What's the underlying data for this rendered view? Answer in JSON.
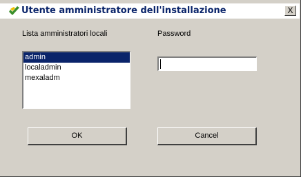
{
  "window": {
    "title": "Utente amministratore dell'installazione",
    "close_glyph": "X"
  },
  "labels": {
    "admin_list": "Lista amministratori locali",
    "password": "Password"
  },
  "admin_list": {
    "items": [
      "admin",
      "localadmin",
      "mexaladm"
    ],
    "selected": "admin"
  },
  "password_field": {
    "value": ""
  },
  "buttons": {
    "ok": "OK",
    "cancel": "Cancel"
  },
  "colors": {
    "title": "#0a246a",
    "selection": "#0a246a",
    "face": "#d4d0c8"
  }
}
